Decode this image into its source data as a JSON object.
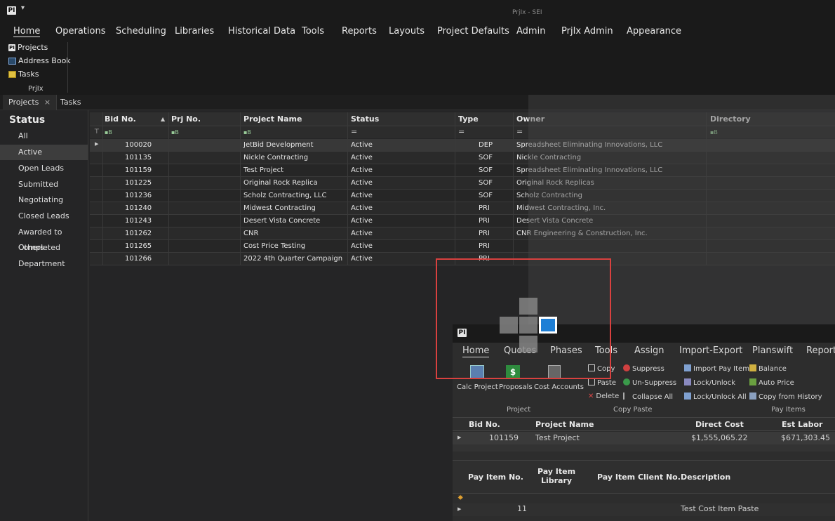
{
  "app": {
    "logo": "PI",
    "title": "PrjIx - SEI"
  },
  "menu": [
    "Home",
    "Operations",
    "Scheduling",
    "Libraries",
    "Historical Data",
    "Tools",
    "Reports",
    "Layouts",
    "Project Defaults",
    "Admin",
    "PrjIx Admin",
    "Appearance"
  ],
  "ribbon": {
    "items": [
      "Projects",
      "Address Book",
      "Tasks"
    ],
    "group_label": "PrjIx"
  },
  "tabs": [
    "Projects",
    "Tasks"
  ],
  "tab_close": "×",
  "sidebar": {
    "heading": "Status",
    "items": [
      "All",
      "Active",
      "Open Leads",
      "Submitted",
      "Negotiating",
      "Closed Leads",
      "Awarded to Others",
      "Completed",
      "Department"
    ],
    "selected": "Active"
  },
  "grid": {
    "columns": [
      "Bid No.",
      "Prj No.",
      "Project Name",
      "Status",
      "Type",
      "Owner",
      "Directory"
    ],
    "filter_eq": "=",
    "rows": [
      [
        "100020",
        "",
        "JetBid Development",
        "Active",
        "DEP",
        "Spreadsheet Eliminating Innovations, LLC"
      ],
      [
        "101135",
        "",
        "Nickle Contracting",
        "Active",
        "SOF",
        "Nickle Contracting"
      ],
      [
        "101159",
        "",
        "Test Project",
        "Active",
        "SOF",
        "Spreadsheet Eliminating Innovations, LLC"
      ],
      [
        "101225",
        "",
        "Original Rock Replica",
        "Active",
        "SOF",
        "Original Rock Replicas"
      ],
      [
        "101236",
        "",
        "Scholz Contracting, LLC",
        "Active",
        "SOF",
        "Scholz Contracting"
      ],
      [
        "101240",
        "",
        "Midwest Contracting",
        "Active",
        "PRI",
        "Midwest Contracting, Inc."
      ],
      [
        "101243",
        "",
        "Desert Vista Concrete",
        "Active",
        "PRI",
        "Desert Vista Concrete"
      ],
      [
        "101262",
        "",
        "CNR",
        "Active",
        "PRI",
        "CNR Engineering & Construction, Inc."
      ],
      [
        "101265",
        "",
        "Cost Price Testing",
        "Active",
        "PRI",
        ""
      ],
      [
        "101266",
        "",
        "2022 4th Quarter Campaign",
        "Active",
        "PRI",
        ""
      ]
    ]
  },
  "sub_window": {
    "logo": "PI",
    "menu": [
      "Home",
      "Quotes",
      "Phases",
      "Tools",
      "Assign",
      "Import-Export",
      "Planswift",
      "Reports"
    ],
    "project_buttons": [
      "Calc Project",
      "Proposals",
      "Cost Accounts"
    ],
    "copy_paste": [
      "Copy",
      "Paste",
      "Delete",
      "Suppress",
      "Un-Suppress",
      "Collapse All"
    ],
    "pay_items_buttons": [
      "Import Pay Item",
      "Lock/Unlock",
      "Lock/Unlock All",
      "Balance",
      "Auto Price",
      "Copy from History"
    ],
    "group_labels": [
      "Project",
      "Copy Paste",
      "Pay Items"
    ],
    "top_grid": {
      "columns": [
        "Bid No.",
        "Project Name",
        "Direct Cost",
        "Est Labor"
      ],
      "row": [
        "101159",
        "Test Project",
        "$1,555,065.22",
        "$671,303.45"
      ]
    },
    "bottom_grid": {
      "columns": [
        "Pay Item No.",
        "Pay Item Library",
        "Pay Item Client No.",
        "Description"
      ],
      "rows": [
        [
          "11",
          "",
          "",
          "Test Cost Item Paste"
        ]
      ]
    }
  },
  "colors": {
    "accent": "#d9413f",
    "dock_blue": "#1e7fd6",
    "background": "#252526"
  }
}
